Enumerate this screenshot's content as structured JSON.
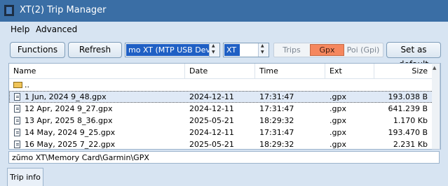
{
  "window": {
    "title": "XT(2) Trip Manager"
  },
  "menu": {
    "help": "Help",
    "advanced": "Advanced"
  },
  "toolbar": {
    "functions_label": "Functions",
    "refresh_label": "Refresh",
    "device_value": "mo XT (MTP USB Device)",
    "model_value": "XT",
    "tabs": {
      "trips": "Trips",
      "gpx": "Gpx",
      "poi": "Poi (Gpi)"
    },
    "active_tab": "Gpx",
    "set_default_label": "Set as default",
    "accent_color": "#f5875e"
  },
  "list": {
    "columns": {
      "name": "Name",
      "date": "Date",
      "time": "Time",
      "ext": "Ext",
      "size": "Size"
    },
    "parent_dir": "..",
    "rows": [
      {
        "name": "1 Jun, 2024 9_48.gpx",
        "date": "2024-12-11",
        "time": "17:31:47",
        "ext": ".gpx",
        "size": "193.038 B"
      },
      {
        "name": "12 Apr, 2024 9_27.gpx",
        "date": "2024-12-11",
        "time": "17:31:47",
        "ext": ".gpx",
        "size": "641.239 B"
      },
      {
        "name": "13 Apr, 2025 8_36.gpx",
        "date": "2025-05-21",
        "time": "18:29:32",
        "ext": ".gpx",
        "size": "1.170 Kb"
      },
      {
        "name": "14 May, 2024 9_25.gpx",
        "date": "2024-12-11",
        "time": "17:31:47",
        "ext": ".gpx",
        "size": "193.470 B"
      },
      {
        "name": "16 May, 2025 7_22.gpx",
        "date": "2025-05-21",
        "time": "18:29:32",
        "ext": ".gpx",
        "size": "2.231 Kb"
      }
    ],
    "selected_row": 0
  },
  "path": {
    "value": "zūmo XT\\Memory Card\\Garmin\\GPX"
  },
  "bottom_tab": {
    "label": "Trip info"
  }
}
